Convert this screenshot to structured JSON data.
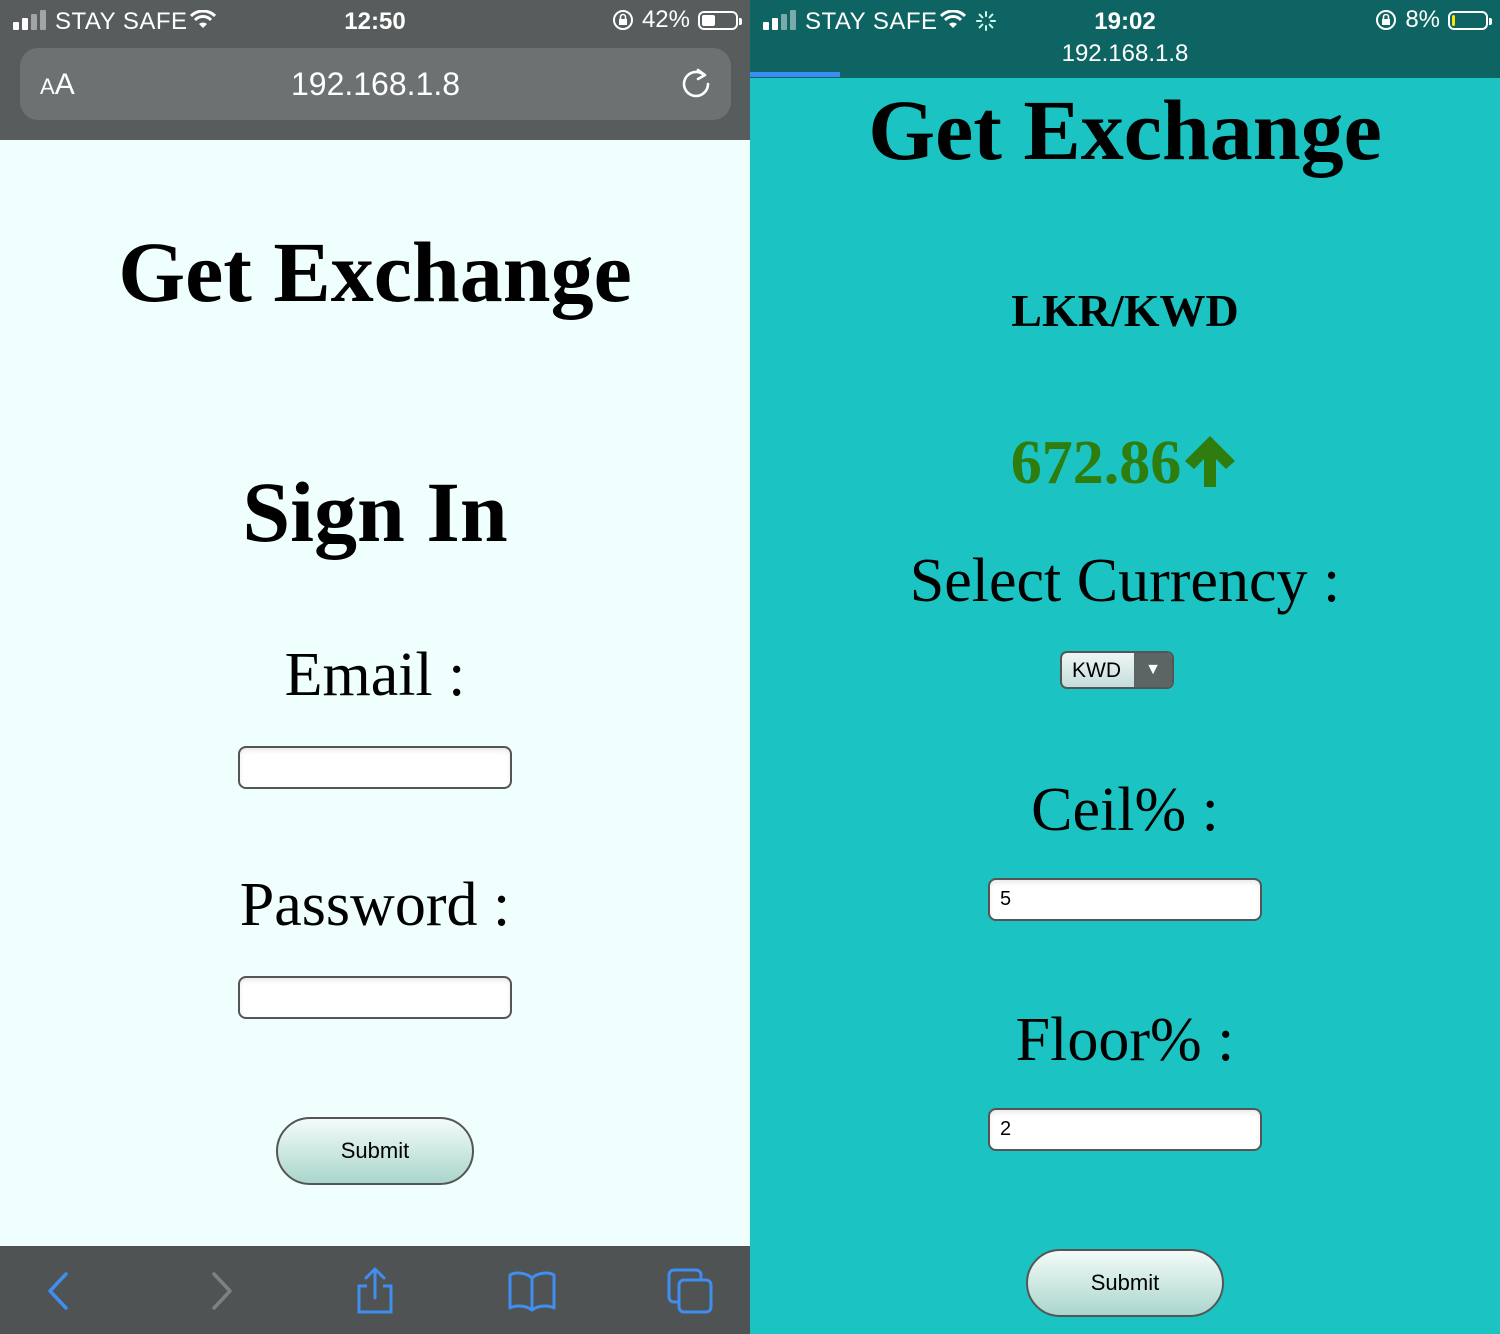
{
  "left": {
    "status": {
      "carrier": "STAY SAFE",
      "time": "12:50",
      "battery": "42%",
      "battery_level": 0.42
    },
    "browser": {
      "text_size_label": "AA",
      "url": "192.168.1.8"
    },
    "page": {
      "title": "Get Exchange",
      "heading": "Sign In",
      "email_label": "Email :",
      "email_value": "",
      "password_label": "Password :",
      "password_value": "",
      "submit_label": "Submit"
    },
    "toolbar": [
      "back-icon",
      "forward-icon",
      "share-icon",
      "bookmarks-icon",
      "tabs-icon"
    ]
  },
  "right": {
    "status": {
      "carrier": "STAY SAFE",
      "time": "19:02",
      "battery": "8%",
      "battery_level": 0.08,
      "url": "192.168.1.8"
    },
    "page": {
      "title": "Get Exchange",
      "pair": "LKR/KWD",
      "rate": "672.86",
      "rate_color": "#2e7d0e",
      "trend": "up",
      "select_label": "Select Currency :",
      "currency_selected": "KWD",
      "ceil_label": "Ceil% :",
      "ceil_value": "5",
      "floor_label": "Floor% :",
      "floor_value": "2",
      "submit_label": "Submit"
    }
  },
  "colors": {
    "left_bg": "#effffe",
    "right_bg": "#1bc3c3",
    "right_header": "#0e6463"
  }
}
